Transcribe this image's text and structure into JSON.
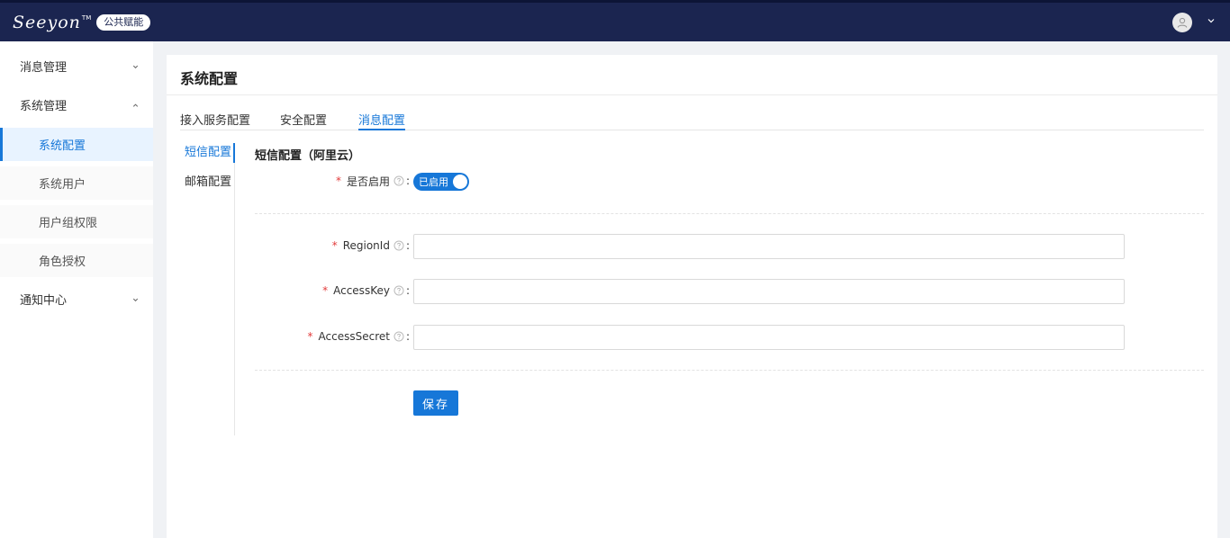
{
  "app": {
    "logo_text": "Seeyon",
    "logo_tm": "TM",
    "badge": "公共赋能"
  },
  "icons": {
    "avatar": "user-avatar-icon",
    "user_menu": "chevron-down-icon",
    "group_collapsed": "chevron-down-icon",
    "group_expanded": "chevron-up-icon",
    "help": "question-circle-icon"
  },
  "colors": {
    "header_bg": "#1b2550",
    "accent": "#1677d8",
    "required": "#e23b3b"
  },
  "sidebar": {
    "groups": [
      {
        "label": "消息管理",
        "expanded": false
      },
      {
        "label": "系统管理",
        "expanded": true,
        "items": [
          {
            "label": "系统配置",
            "active": true
          },
          {
            "label": "系统用户",
            "active": false
          },
          {
            "label": "用户组权限",
            "active": false
          },
          {
            "label": "角色授权",
            "active": false
          }
        ]
      },
      {
        "label": "通知中心",
        "expanded": false
      }
    ]
  },
  "page": {
    "title": "系统配置",
    "tabs": [
      {
        "label": "接入服务配置",
        "active": false
      },
      {
        "label": "安全配置",
        "active": false
      },
      {
        "label": "消息配置",
        "active": true
      }
    ],
    "subnav": [
      {
        "label": "短信配置",
        "active": true
      },
      {
        "label": "邮箱配置",
        "active": false
      }
    ]
  },
  "form": {
    "section_title": "短信配置（阿里云）",
    "enable": {
      "label": "是否启用",
      "switch_text": "已启用",
      "on": true
    },
    "fields": [
      {
        "label": "RegionId",
        "value": "",
        "placeholder": ""
      },
      {
        "label": "AccessKey",
        "value": "",
        "placeholder": ""
      },
      {
        "label": "AccessSecret",
        "value": "",
        "placeholder": ""
      }
    ],
    "required_mark": "*",
    "colon": ":",
    "save_label": "保存"
  }
}
